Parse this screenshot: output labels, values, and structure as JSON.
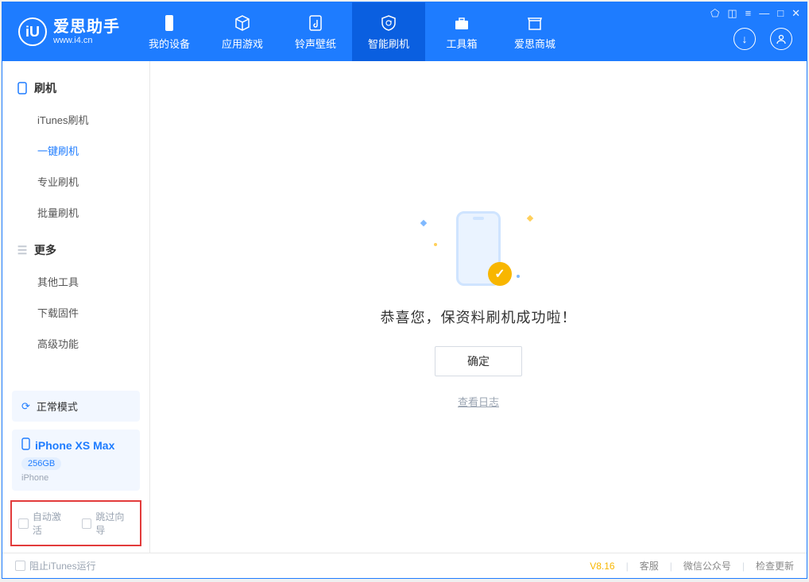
{
  "app": {
    "name": "爱思助手",
    "site": "www.i4.cn"
  },
  "nav": {
    "tabs": [
      {
        "label": "我的设备"
      },
      {
        "label": "应用游戏"
      },
      {
        "label": "铃声壁纸"
      },
      {
        "label": "智能刷机"
      },
      {
        "label": "工具箱"
      },
      {
        "label": "爱思商城"
      }
    ],
    "activeIndex": 3
  },
  "sidebar": {
    "groups": [
      {
        "title": "刷机",
        "items": [
          {
            "label": "iTunes刷机"
          },
          {
            "label": "一键刷机"
          },
          {
            "label": "专业刷机"
          },
          {
            "label": "批量刷机"
          }
        ],
        "activeItemIndex": 1
      },
      {
        "title": "更多",
        "items": [
          {
            "label": "其他工具"
          },
          {
            "label": "下载固件"
          },
          {
            "label": "高级功能"
          }
        ]
      }
    ],
    "mode_label": "正常模式",
    "device": {
      "name": "iPhone XS Max",
      "storage": "256GB",
      "type": "iPhone"
    },
    "options": {
      "auto_activate": "自动激活",
      "skip_guide": "跳过向导"
    }
  },
  "main": {
    "success_text": "恭喜您，保资料刷机成功啦！",
    "confirm_label": "确定",
    "log_link": "查看日志"
  },
  "footer": {
    "block_itunes": "阻止iTunes运行",
    "version": "V8.16",
    "links": {
      "kefu": "客服",
      "wechat": "微信公众号",
      "update": "检查更新"
    }
  }
}
